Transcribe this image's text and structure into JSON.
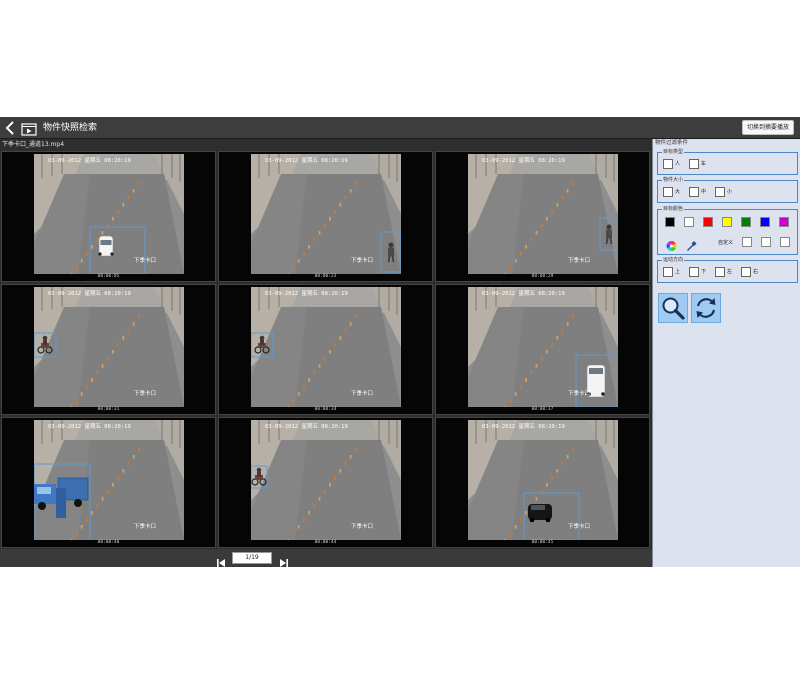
{
  "header": {
    "title": "物件快照检索",
    "switch_label": "切换到摘要播放"
  },
  "video": {
    "file_name": "下季卡口_通道13.mp4"
  },
  "thumbnails": [
    {
      "overlay_date": "03-09-2012",
      "overlay_day": "星期五",
      "overlay_time": "08:20:19",
      "location": "下季卡口",
      "time": "00:00:05",
      "object": "white-car",
      "box": "bottom-center"
    },
    {
      "overlay_date": "03-09-2012",
      "overlay_day": "星期五",
      "overlay_time": "08:20:19",
      "location": "下季卡口",
      "time": "00:00:23",
      "object": "person",
      "box": "bottom-right"
    },
    {
      "overlay_date": "03-09-2012",
      "overlay_day": "星期五",
      "overlay_time": "08:20:19",
      "location": "下季卡口",
      "time": "00:00:29",
      "object": "person",
      "box": "right"
    },
    {
      "overlay_date": "03-09-2012",
      "overlay_day": "星期五",
      "overlay_time": "08:20:19",
      "location": "下季卡口",
      "time": "00:00:31",
      "object": "motorbike",
      "box": "left"
    },
    {
      "overlay_date": "03-09-2012",
      "overlay_day": "星期五",
      "overlay_time": "08:20:19",
      "location": "下季卡口",
      "time": "00:00:34",
      "object": "motorbike",
      "box": "left"
    },
    {
      "overlay_date": "03-09-2012",
      "overlay_day": "星期五",
      "overlay_time": "08:20:19",
      "location": "下季卡口",
      "time": "00:00:37",
      "object": "white-van",
      "box": "bottom-right"
    },
    {
      "overlay_date": "03-09-2012",
      "overlay_day": "星期五",
      "overlay_time": "08:20:19",
      "location": "下季卡口",
      "time": "00:00:40",
      "object": "blue-truck",
      "box": "bottom-left"
    },
    {
      "overlay_date": "03-09-2012",
      "overlay_day": "星期五",
      "overlay_time": "08:20:19",
      "location": "下季卡口",
      "time": "00:00:44",
      "object": "motorbike",
      "box": "left-small"
    },
    {
      "overlay_date": "03-09-2012",
      "overlay_day": "星期五",
      "overlay_time": "08:20:19",
      "location": "下季卡口",
      "time": "00:00:45",
      "object": "black-car",
      "box": "bottom-center"
    }
  ],
  "pager": {
    "page_value": "1/19"
  },
  "filter": {
    "title": "物件过滤条件",
    "target_type": {
      "label": "目标类型",
      "options": [
        "人",
        "车"
      ]
    },
    "object_size": {
      "label": "物件大小",
      "options": [
        "大",
        "中",
        "小"
      ]
    },
    "target_color": {
      "label": "目标颜色",
      "swatches": [
        "#000000",
        "#ffffff",
        "#ff0000",
        "#ffff00",
        "#008000",
        "#0000ff",
        "#cc00cc"
      ],
      "custom_label": "自定义"
    },
    "direction": {
      "label": "运动方向",
      "options": [
        "上",
        "下",
        "左",
        "右"
      ]
    }
  },
  "icons": {
    "back": "chevron-left-icon",
    "app": "video-folder-icon",
    "search": "magnifier-icon",
    "reset": "refresh-icon",
    "prev": "skip-back-icon",
    "next": "skip-forward-icon",
    "palette": "color-wheel-icon",
    "picker": "eyedropper-icon"
  }
}
